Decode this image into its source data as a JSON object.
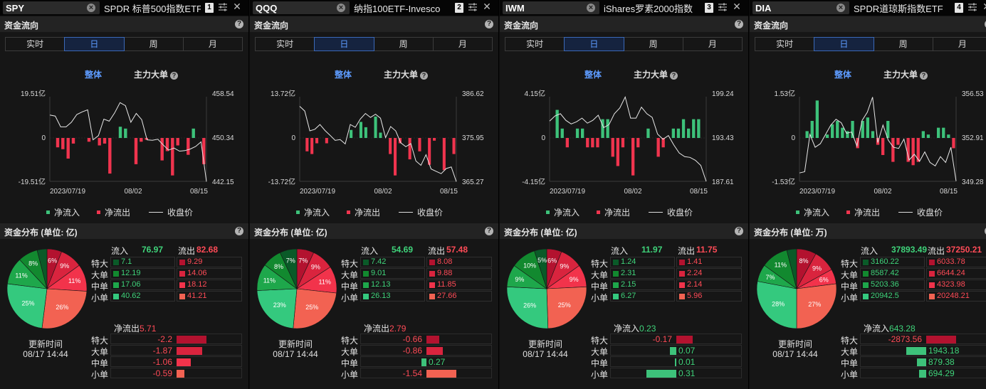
{
  "labels": {
    "flow_title": "资金流向",
    "tabs": [
      "实时",
      "日",
      "周",
      "月"
    ],
    "active_tab": 1,
    "opt_all": "整体",
    "opt_main": "主力大单",
    "legend_in": "净流入",
    "legend_out": "净流出",
    "legend_close": "收盘价",
    "inflow": "流入",
    "outflow": "流出",
    "sizes": [
      "特大",
      "大单",
      "中单",
      "小单"
    ],
    "update_label": "更新时间",
    "x_ticks": [
      "2023/07/19",
      "08/02",
      "08/15"
    ]
  },
  "colors": {
    "in_shades": [
      "#0a5a28",
      "#12892f",
      "#1ea74b",
      "#34c97e"
    ],
    "out_shades": [
      "#b3122f",
      "#d9243e",
      "#f2334b",
      "#f26252"
    ],
    "bar_in": "#3dc27a",
    "bar_out": "#f0344e",
    "accent": "#5d9bff"
  },
  "panels": [
    {
      "symbol": "SPY",
      "name": "SPDR 标普500指数ETF",
      "tab_num": "1",
      "dist_title": "资金分布 (单位: 亿)",
      "y_left": [
        "19.51亿",
        "0",
        "-19.51亿"
      ],
      "y_right": [
        "458.54",
        "450.34",
        "442.15"
      ],
      "bars": [
        0,
        -5,
        -6,
        -11,
        -3,
        0,
        0,
        -2,
        0,
        -4,
        -3,
        -19,
        0,
        6,
        5,
        0,
        -14,
        -2,
        -1,
        0,
        0,
        -12,
        -7,
        -20,
        -4,
        0,
        -9,
        5,
        0,
        -14
      ],
      "closes": [
        455.0,
        454.8,
        452.7,
        452.7,
        453.6,
        455.1,
        455.6,
        456.0,
        450.2,
        451.0,
        454.2,
        453.8,
        455.4,
        457.4,
        456.8,
        453.6,
        455.3,
        454.1,
        450.2,
        450.1,
        450.3,
        449.2,
        448.2,
        448.6,
        448.0,
        448.1,
        448.4,
        448.9,
        449.8,
        442.1
      ],
      "totals": {
        "inflow": "76.97",
        "outflow": "82.68"
      },
      "rows_in": [
        "7.1",
        "12.19",
        "17.06",
        "40.62"
      ],
      "rows_out": [
        "9.29",
        "14.06",
        "18.12",
        "41.21"
      ],
      "pie": [
        {
          "label": "6%",
          "value": 6,
          "side": "out",
          "shade": 0
        },
        {
          "label": "9%",
          "value": 9,
          "side": "out",
          "shade": 1
        },
        {
          "label": "11%",
          "value": 11,
          "side": "out",
          "shade": 2
        },
        {
          "label": "26%",
          "value": 26,
          "side": "out",
          "shade": 3
        },
        {
          "label": "25%",
          "value": 25,
          "side": "in",
          "shade": 3
        },
        {
          "label": "11%",
          "value": 11,
          "side": "in",
          "shade": 2
        },
        {
          "label": "8%",
          "value": 8,
          "side": "in",
          "shade": 1
        },
        {
          "label": "",
          "value": 4,
          "side": "in",
          "shade": 0
        }
      ],
      "net_title": "净流出",
      "net_total": "5.71",
      "net_dir": "out",
      "net_rows": [
        {
          "value": -2.2,
          "text": "-2.2"
        },
        {
          "value": -1.87,
          "text": "-1.87"
        },
        {
          "value": -1.06,
          "text": "-1.06"
        },
        {
          "value": -0.59,
          "text": "-0.59"
        }
      ],
      "update_time": "08/17 14:44"
    },
    {
      "symbol": "QQQ",
      "name": "纳指100ETF-Invesco",
      "tab_num": "2",
      "dist_title": "资金分布 (单位: 亿)",
      "y_left": [
        "13.72亿",
        "0",
        "-13.72亿"
      ],
      "y_right": [
        "386.62",
        "375.95",
        "365.27"
      ],
      "bars": [
        0,
        -5,
        -6,
        -2,
        0,
        -2,
        0,
        0,
        0,
        0,
        3,
        0,
        6,
        4,
        0,
        8,
        2,
        0,
        -6,
        -14,
        -2,
        0,
        -8,
        0,
        -5,
        0,
        -10,
        -1,
        0,
        -12,
        0,
        -6
      ],
      "closes": [
        384.2,
        383.0,
        378.0,
        378.4,
        379.6,
        378.1,
        376.9,
        375.6,
        375.8,
        374.7,
        379.6,
        378.9,
        381.0,
        382.4,
        381.4,
        382.2,
        381.2,
        376.3,
        379.1,
        378.0,
        375.0,
        374.0,
        374.8,
        370.4,
        369.3,
        372.0,
        368.4,
        367.8,
        367.2,
        368.5,
        368.9,
        365.2
      ],
      "totals": {
        "inflow": "54.69",
        "outflow": "57.48"
      },
      "rows_in": [
        "7.42",
        "9.01",
        "12.13",
        "26.13"
      ],
      "rows_out": [
        "8.08",
        "9.88",
        "11.85",
        "27.66"
      ],
      "pie": [
        {
          "label": "7%",
          "value": 7,
          "side": "out",
          "shade": 0
        },
        {
          "label": "9%",
          "value": 9,
          "side": "out",
          "shade": 1
        },
        {
          "label": "11%",
          "value": 11,
          "side": "out",
          "shade": 2
        },
        {
          "label": "25%",
          "value": 25,
          "side": "out",
          "shade": 3
        },
        {
          "label": "23%",
          "value": 23,
          "side": "in",
          "shade": 3
        },
        {
          "label": "11%",
          "value": 11,
          "side": "in",
          "shade": 2
        },
        {
          "label": "8%",
          "value": 8,
          "side": "in",
          "shade": 1
        },
        {
          "label": "7%",
          "value": 7,
          "side": "in",
          "shade": 0
        }
      ],
      "net_title": "净流出",
      "net_total": "2.79",
      "net_dir": "out",
      "net_rows": [
        {
          "value": -0.66,
          "text": "-0.66"
        },
        {
          "value": -0.86,
          "text": "-0.86"
        },
        {
          "value": 0.27,
          "text": "0.27"
        },
        {
          "value": -1.54,
          "text": "-1.54"
        }
      ],
      "update_time": "08/17 14:44"
    },
    {
      "symbol": "IWM",
      "name": "iShares罗素2000指数",
      "tab_num": "3",
      "dist_title": "资金分布 (单位: 亿)",
      "y_left": [
        "4.15亿",
        "0",
        "-4.15亿"
      ],
      "y_right": [
        "199.24",
        "193.43",
        "187.61"
      ],
      "bars": [
        0,
        3,
        1,
        -1,
        0,
        1,
        1,
        -1,
        -1,
        -1,
        2,
        2,
        -2,
        -3,
        -1,
        0,
        -4,
        -1,
        0,
        1,
        0,
        -2,
        -1,
        0,
        1,
        1,
        2,
        1,
        2,
        2,
        0
      ],
      "closes": [
        195.9,
        196.6,
        196.9,
        196.0,
        195.5,
        195.8,
        196.3,
        195.6,
        196.0,
        196.7,
        195.0,
        195.4,
        196.9,
        197.7,
        199.2,
        196.3,
        196.3,
        197.8,
        196.9,
        196.4,
        194.1,
        193.4,
        193.9,
        192.6,
        191.5,
        191.0,
        190.9,
        190.5,
        189.8,
        187.6
      ],
      "totals": {
        "inflow": "11.97",
        "outflow": "11.75"
      },
      "rows_in": [
        "1.24",
        "2.31",
        "2.15",
        "6.27"
      ],
      "rows_out": [
        "1.41",
        "2.24",
        "2.14",
        "5.96"
      ],
      "pie": [
        {
          "label": "6%",
          "value": 6,
          "side": "out",
          "shade": 0
        },
        {
          "label": "9%",
          "value": 9,
          "side": "out",
          "shade": 1
        },
        {
          "label": "9%",
          "value": 9,
          "side": "out",
          "shade": 2
        },
        {
          "label": "25%",
          "value": 25,
          "side": "out",
          "shade": 3
        },
        {
          "label": "26%",
          "value": 26,
          "side": "in",
          "shade": 3
        },
        {
          "label": "9%",
          "value": 9,
          "side": "in",
          "shade": 2
        },
        {
          "label": "10%",
          "value": 10,
          "side": "in",
          "shade": 1
        },
        {
          "label": "5%",
          "value": 5,
          "side": "in",
          "shade": 0
        }
      ],
      "net_title": "净流入",
      "net_total": "0.23",
      "net_dir": "in",
      "net_rows": [
        {
          "value": -0.17,
          "text": "-0.17"
        },
        {
          "value": 0.07,
          "text": "0.07"
        },
        {
          "value": 0.01,
          "text": "0.01"
        },
        {
          "value": 0.31,
          "text": "0.31"
        }
      ],
      "update_time": "08/17 14:44"
    },
    {
      "symbol": "DIA",
      "name": "SPDR道琼斯指数ETF",
      "tab_num": "4",
      "dist_title": "资金分布 (单位: 万)",
      "y_left": [
        "1.53亿",
        "0",
        "-1.53亿"
      ],
      "y_right": [
        "356.53",
        "352.91",
        "349.28"
      ],
      "bars": [
        0,
        0.2,
        0.5,
        1.1,
        0,
        0.1,
        0.4,
        0.5,
        0.3,
        0.2,
        0.5,
        -0.3,
        0.5,
        0.6,
        0.2,
        -0.2,
        -0.5,
        0.5,
        -0.7,
        -0.2,
        0,
        -0.7,
        -0.8,
        -0.7,
        0.2,
        0.1,
        0,
        0.3,
        0.3,
        0.1,
        -0.3
      ],
      "closes": [
        350.0,
        350.1,
        353.3,
        352.2,
        352.5,
        353.3,
        354.1,
        354.6,
        354.3,
        353.4,
        353.5,
        352.3,
        354.5,
        355.2,
        356.5,
        352.6,
        354.1,
        352.8,
        352.2,
        352.1,
        352.9,
        351.1,
        351.6,
        351.0,
        351.8,
        350.9,
        350.6,
        351.4,
        350.9,
        352.2,
        349.3
      ],
      "totals": {
        "inflow": "37893.49",
        "outflow": "37250.21"
      },
      "rows_in": [
        "3160.22",
        "8587.42",
        "5203.36",
        "20942.5"
      ],
      "rows_out": [
        "6033.78",
        "6644.24",
        "4323.98",
        "20248.21"
      ],
      "pie": [
        {
          "label": "8%",
          "value": 8,
          "side": "out",
          "shade": 0
        },
        {
          "label": "9%",
          "value": 9,
          "side": "out",
          "shade": 1
        },
        {
          "label": "6%",
          "value": 6,
          "side": "out",
          "shade": 2
        },
        {
          "label": "27%",
          "value": 27,
          "side": "out",
          "shade": 3
        },
        {
          "label": "28%",
          "value": 28,
          "side": "in",
          "shade": 3
        },
        {
          "label": "7%",
          "value": 7,
          "side": "in",
          "shade": 2
        },
        {
          "label": "11%",
          "value": 11,
          "side": "in",
          "shade": 1
        },
        {
          "label": "",
          "value": 4,
          "side": "in",
          "shade": 0
        }
      ],
      "net_title": "净流入",
      "net_total": "643.28",
      "net_dir": "in",
      "net_rows": [
        {
          "value": -2873.56,
          "text": "-2873.56"
        },
        {
          "value": 1943.18,
          "text": "1943.18"
        },
        {
          "value": 879.38,
          "text": "879.38"
        },
        {
          "value": 694.29,
          "text": "694.29"
        }
      ],
      "update_time": "08/17 14:44"
    }
  ]
}
